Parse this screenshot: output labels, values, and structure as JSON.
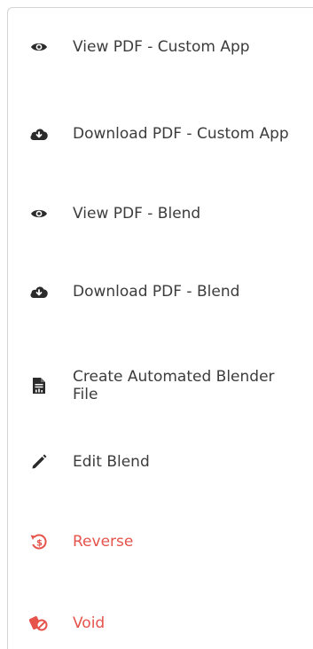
{
  "menu": {
    "items": [
      {
        "label": "View PDF - Custom App",
        "icon": "eye-icon",
        "color": "#3c3c3c"
      },
      {
        "label": "Download PDF - Custom App",
        "icon": "cloud-download-icon",
        "color": "#3c3c3c"
      },
      {
        "label": "View PDF - Blend",
        "icon": "eye-icon",
        "color": "#3c3c3c"
      },
      {
        "label": "Download PDF - Blend",
        "icon": "cloud-download-icon",
        "color": "#3c3c3c"
      },
      {
        "label": "Create Automated Blender File",
        "icon": "document-chart-icon",
        "color": "#3c3c3c"
      },
      {
        "label": "Edit Blend",
        "icon": "pencil-icon",
        "color": "#3c3c3c"
      },
      {
        "label": "Reverse",
        "icon": "reverse-dollar-icon",
        "color": "#e5534b"
      },
      {
        "label": "Void",
        "icon": "void-icon",
        "color": "#e5534b"
      }
    ]
  }
}
